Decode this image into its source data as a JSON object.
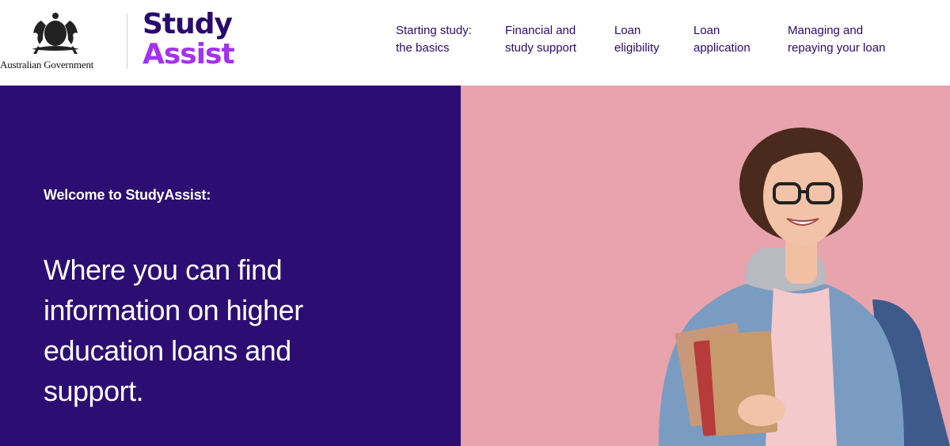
{
  "header": {
    "gov_logo_text": "Australian Government",
    "brand_line1": "Study",
    "brand_line2": "Assist"
  },
  "nav": [
    {
      "line1": "Starting study:",
      "line2": "the basics"
    },
    {
      "line1": "Financial and",
      "line2": "study support"
    },
    {
      "line1": "Loan",
      "line2": "eligibility"
    },
    {
      "line1": "Loan",
      "line2": "application"
    },
    {
      "line1": "Managing and",
      "line2": "repaying your loan"
    }
  ],
  "hero": {
    "welcome": "Welcome to StudyAssist:",
    "headline_lines": [
      "Where you can find",
      "information on higher",
      "education loans and",
      "support."
    ]
  },
  "colors": {
    "brand_dark": "#2a0a6e",
    "brand_accent": "#a531f0",
    "hero_bg": "#2c0e73",
    "photo_bg": "#e8a3ad"
  }
}
